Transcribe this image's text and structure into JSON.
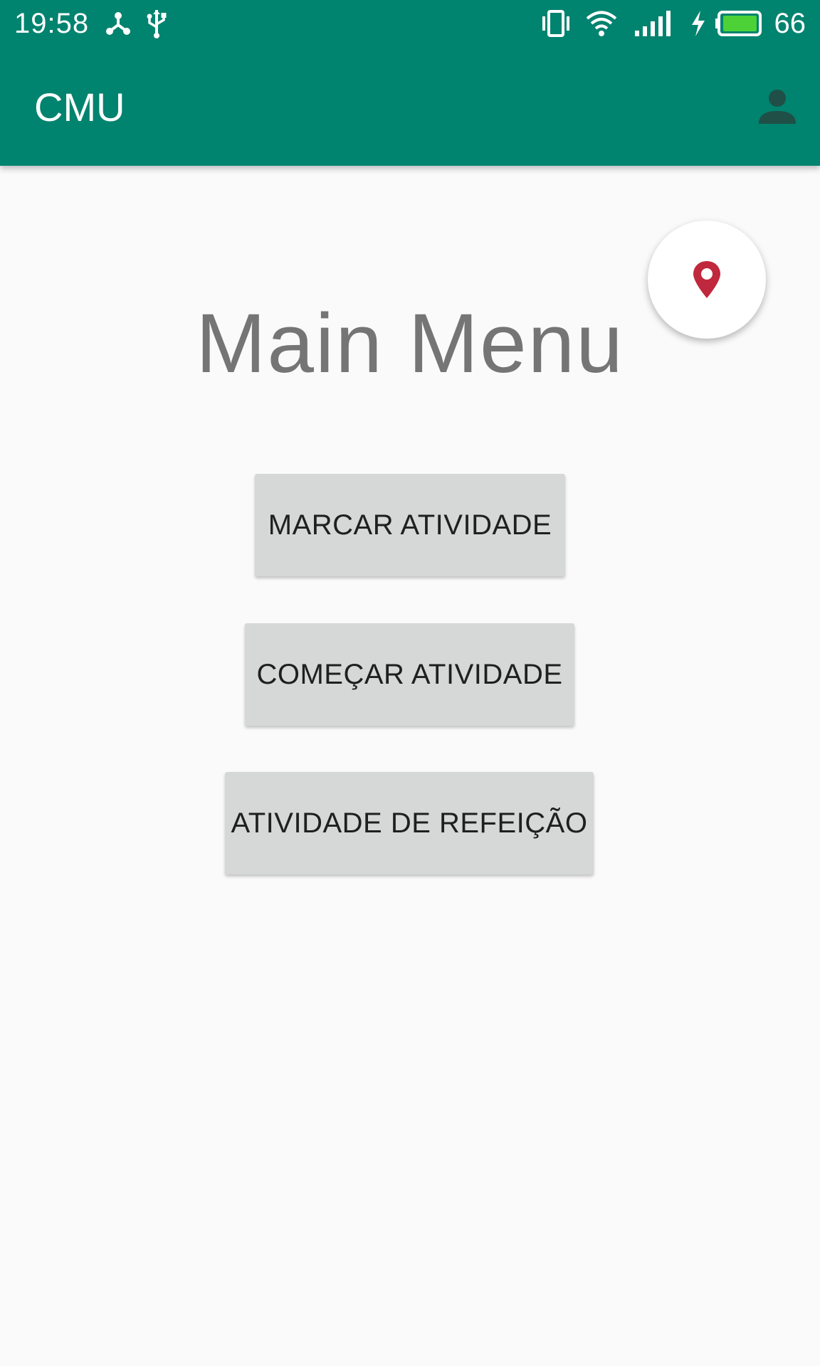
{
  "status_bar": {
    "time": "19:58",
    "battery_level": "66",
    "icons": [
      "nearby-share-icon",
      "usb-icon",
      "vibrate-icon",
      "wifi-icon",
      "signal-icon",
      "charging-icon",
      "battery-icon"
    ],
    "battery_fill_color": "#4cd137"
  },
  "app_bar": {
    "title": "CMU",
    "background_color": "#00836f",
    "account_icon": "account-circle-icon"
  },
  "fab": {
    "icon": "location-pin-icon",
    "icon_color": "#c0283d"
  },
  "main": {
    "title": "Main Menu",
    "buttons": [
      {
        "label": "MARCAR ATIVIDADE"
      },
      {
        "label": "COMEÇAR ATIVIDADE"
      },
      {
        "label": "ATIVIDADE DE REFEIÇÃO"
      }
    ]
  }
}
